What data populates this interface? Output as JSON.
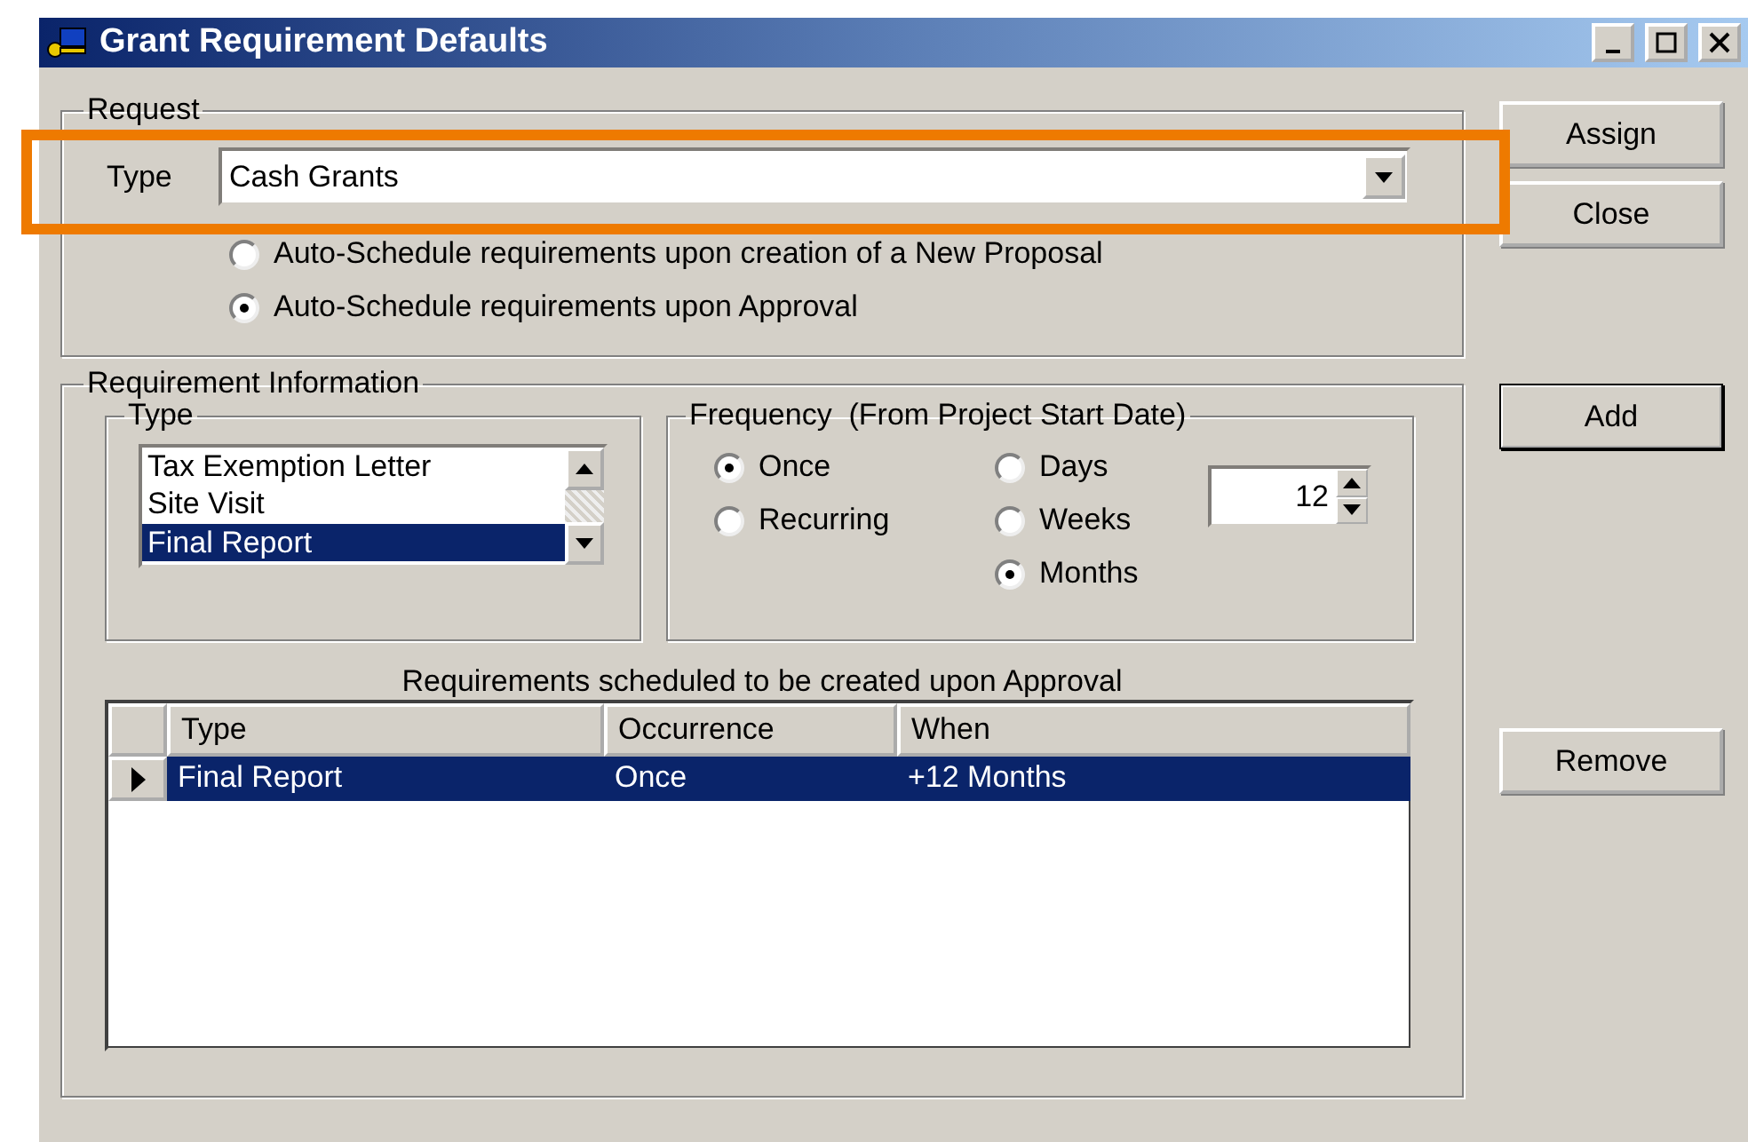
{
  "window": {
    "title": "Grant Requirement Defaults"
  },
  "request": {
    "legend": "Request",
    "type_label": "Type",
    "type_value": "Cash Grants",
    "highlighted": true,
    "options": [
      {
        "label": "Auto-Schedule requirements upon creation of a New Proposal",
        "selected": false
      },
      {
        "label": "Auto-Schedule requirements upon Approval",
        "selected": true
      }
    ]
  },
  "top_buttons": [
    {
      "label": "Assign",
      "default": false
    },
    {
      "label": "Close",
      "default": false
    }
  ],
  "add_button": {
    "label": "Add",
    "default": true
  },
  "remove_button": {
    "label": "Remove",
    "default": false
  },
  "requirement_info": {
    "legend": "Requirement Information",
    "type_group": {
      "legend": "Type",
      "items": [
        {
          "label": "Tax Exemption Letter",
          "selected": false
        },
        {
          "label": "Site Visit",
          "selected": false
        },
        {
          "label": "Final Report",
          "selected": true
        }
      ]
    },
    "frequency": {
      "legend": "Frequency  (From Project Start Date)",
      "occurrence": [
        {
          "label": "Once",
          "selected": true
        },
        {
          "label": "Recurring",
          "selected": false
        }
      ],
      "units": [
        {
          "label": "Days",
          "selected": false
        },
        {
          "label": "Weeks",
          "selected": false
        },
        {
          "label": "Months",
          "selected": true
        }
      ],
      "interval": "12"
    },
    "caption": "Requirements scheduled to be created upon Approval",
    "table": {
      "columns": [
        "Type",
        "Occurrence",
        "When"
      ],
      "rows": [
        {
          "cells": [
            "Final Report",
            "Once",
            "+12 Months"
          ],
          "selected": true
        }
      ]
    }
  }
}
